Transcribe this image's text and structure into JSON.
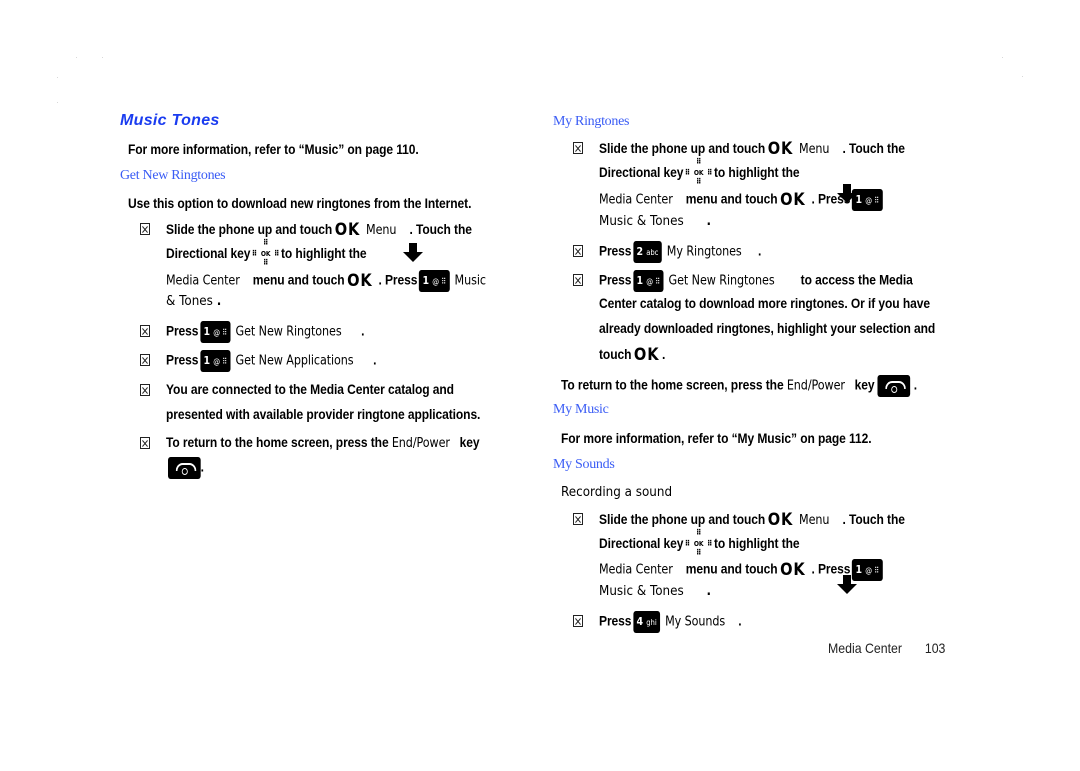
{
  "page": {
    "footer_section": "Media Center",
    "footer_page": "103"
  },
  "left": {
    "heading": "Music  Tones",
    "intro": "For more information, refer to “Music” on page 110.",
    "sub1": "Get New Ringtones",
    "sub1_desc": "Use this option to download new ringtones from the Internet.",
    "steps": [
      {
        "line1_a": "Slide the phone up and touch",
        "line1_ok": "OK",
        "line1_b": "Menu",
        "line1_c": ". Touch the",
        "line2_a": "Directional key",
        "line2_b": "to highlight the",
        "line3_a": "Media Center",
        "line3_b": "menu and touch",
        "line3_ok": "OK",
        "line3_c": ". Press",
        "line3_key": "1",
        "line3_d": "Music",
        "line4": "& Tones",
        "line4_end": "."
      },
      {
        "press": "Press",
        "key": "1",
        "label": "Get New Ringtones",
        "end": "."
      },
      {
        "press": "Press",
        "key": "1",
        "label": "Get New Applications",
        "end": "."
      },
      {
        "text1_a": "You are connected to the",
        "text1_b": "Media Center",
        "text1_c": "catalog and",
        "text2": "presented with available provider ringtone applications."
      },
      {
        "text1_a": "To return to the home screen, press the",
        "text1_b": "End/Power",
        "text1_c": "key",
        "end": "."
      }
    ]
  },
  "right": {
    "sub_ringtones": "My Ringtones",
    "ringtone_steps": [
      {
        "line1_a": "Slide the phone up and touch",
        "line1_ok": "OK",
        "line1_b": "Menu",
        "line1_c": ". Touch the",
        "line2_a": "Directional key",
        "line2_b": "to highlight the",
        "line3_a": "Media Center",
        "line3_b": "menu and touch",
        "line3_ok": "OK",
        "line3_c": ". Press",
        "line3_key": "1",
        "line4": "Music & Tones",
        "line4_end": "."
      },
      {
        "press": "Press",
        "key": "2",
        "key_sub": "abc",
        "label": "My Ringtones",
        "end": "."
      },
      {
        "press": "Press",
        "key": "1",
        "label": "Get New Ringtones",
        "line1_c": "to access the Media",
        "line2": "Center catalog to download more ringtones. Or if you have",
        "line3": "already downloaded ringtones, highlight your selection and",
        "line4_a": "touch",
        "line4_ok": "OK",
        "line4_end": "."
      }
    ],
    "return_a": "To return to the home screen, press the",
    "return_b": "End/Power",
    "return_c": "key",
    "return_end": ".",
    "sub_music": "My Music",
    "music_desc": "For more information, refer to “My Music” on page 112.",
    "sub_sounds": "My Sounds",
    "sounds_sub": "Recording a sound",
    "sound_steps": [
      {
        "line1_a": "Slide the phone up and touch",
        "line1_ok": "OK",
        "line1_b": "Menu",
        "line1_c": ". Touch the",
        "line2_a": "Directional key",
        "line2_b": "to highlight the",
        "line3_a": "Media Center",
        "line3_b": "menu and touch",
        "line3_ok": "OK",
        "line3_c": ". Press",
        "line3_key": "1",
        "line4": "Music & Tones",
        "line4_end": "."
      },
      {
        "press": "Press",
        "key": "4",
        "key_sub": "ghi",
        "label": "My Sounds",
        "end": "."
      }
    ]
  },
  "icons": {
    "bullet": "step-bullet-icon",
    "ok": "ok-key-icon",
    "dpad": "directional-key-icon",
    "arrow": "down-arrow-icon",
    "key": "numeric-key-icon",
    "end": "end-power-key-icon"
  },
  "colors": {
    "heading": "#1a3cf0",
    "subheading": "#3a5cf5",
    "text": "#000000"
  }
}
